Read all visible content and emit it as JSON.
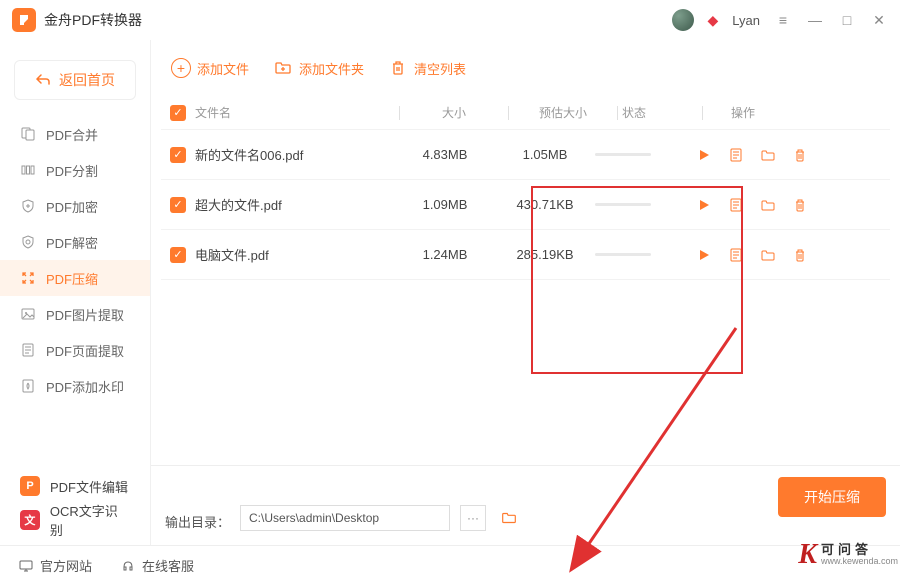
{
  "titlebar": {
    "app_name": "金舟PDF转换器",
    "username": "Lyan"
  },
  "sidebar": {
    "back": "返回首页",
    "items": [
      {
        "icon": "merge",
        "label": "PDF合并"
      },
      {
        "icon": "split",
        "label": "PDF分割"
      },
      {
        "icon": "encrypt",
        "label": "PDF加密"
      },
      {
        "icon": "decrypt",
        "label": "PDF解密"
      },
      {
        "icon": "compress",
        "label": "PDF压缩"
      },
      {
        "icon": "image",
        "label": "PDF图片提取"
      },
      {
        "icon": "page",
        "label": "PDF页面提取"
      },
      {
        "icon": "watermark",
        "label": "PDF添加水印"
      }
    ],
    "tools": [
      {
        "badge": "P",
        "color": "orange",
        "label": "PDF文件编辑"
      },
      {
        "badge": "文",
        "color": "red",
        "label": "OCR文字识别"
      }
    ]
  },
  "toolbar": {
    "add_file": "添加文件",
    "add_folder": "添加文件夹",
    "clear": "清空列表"
  },
  "table": {
    "headers": {
      "name": "文件名",
      "size": "大小",
      "est": "预估大小",
      "status": "状态",
      "ops": "操作"
    },
    "rows": [
      {
        "name": "新的文件名006.pdf",
        "size": "4.83MB",
        "est": "1.05MB"
      },
      {
        "name": "超大的文件.pdf",
        "size": "1.09MB",
        "est": "430.71KB"
      },
      {
        "name": "电脑文件.pdf",
        "size": "1.24MB",
        "est": "285.19KB"
      }
    ]
  },
  "footer": {
    "output_label": "输出目录：",
    "output_path": "C:\\Users\\admin\\Desktop",
    "start": "开始压缩"
  },
  "bottombar": {
    "website": "官方网站",
    "support": "在线客服"
  },
  "watermark": {
    "cn": "可问答",
    "en": "www.kewenda.com"
  }
}
